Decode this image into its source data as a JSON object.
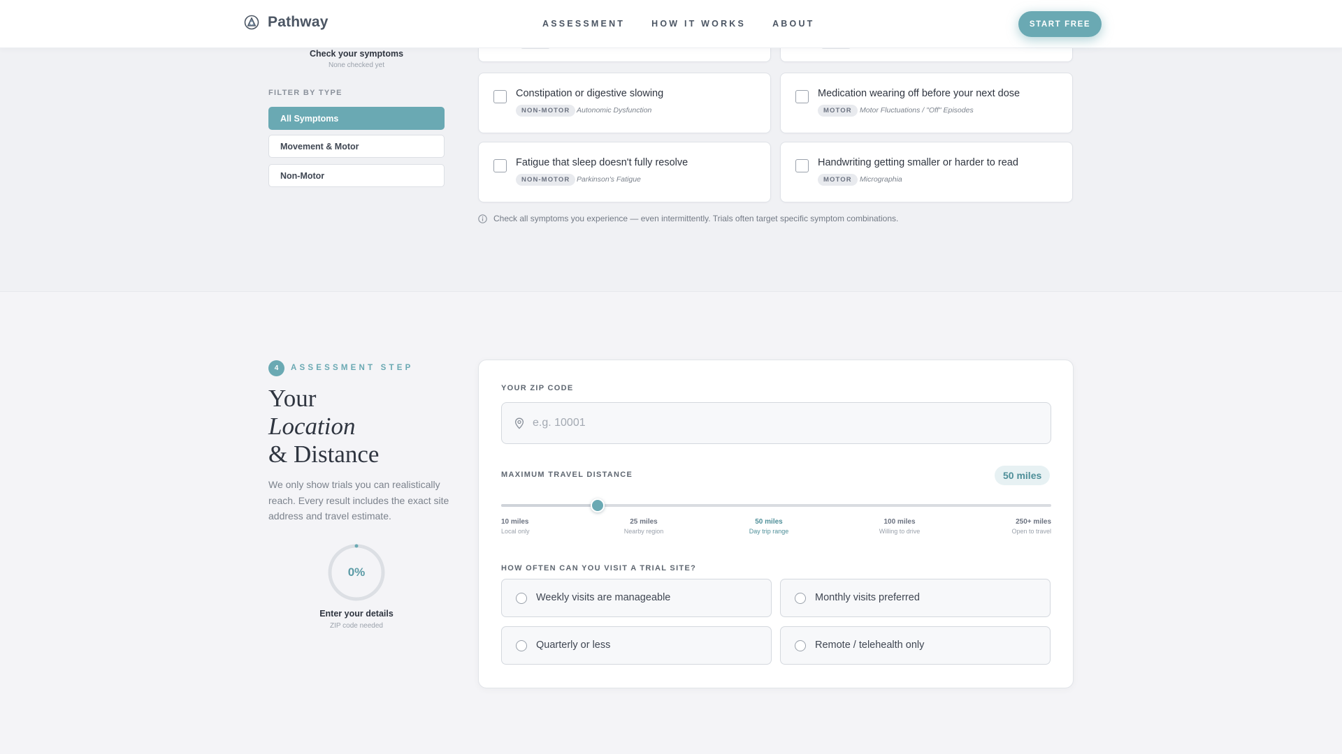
{
  "header": {
    "brand": "Pathway",
    "nav": [
      "ASSESSMENT",
      "HOW IT WORKS",
      "ABOUT"
    ],
    "cta": "START FREE"
  },
  "symptoms": {
    "sidebar_title": "Check your symptoms",
    "sidebar_sub": "None checked yet",
    "filter_label": "FILTER BY TYPE",
    "filters": [
      "All Symptoms",
      "Movement & Motor",
      "Non-Motor"
    ],
    "cards": [
      {
        "title": "Constipation or digestive slowing",
        "tag": "NON-MOTOR",
        "sub": "Autonomic Dysfunction"
      },
      {
        "title": "Medication wearing off before your next dose",
        "tag": "MOTOR",
        "sub": "Motor Fluctuations / \"Off\" Episodes"
      },
      {
        "title": "Fatigue that sleep doesn't fully resolve",
        "tag": "NON-MOTOR",
        "sub": "Parkinson's Fatigue"
      },
      {
        "title": "Handwriting getting smaller or harder to read",
        "tag": "MOTOR",
        "sub": "Micrographia"
      }
    ],
    "hint": "Check all symptoms you experience — even intermittently. Trials often target specific symptom combinations."
  },
  "location": {
    "step_number": "4",
    "step_label": "ASSESSMENT STEP",
    "heading_line1": "Your",
    "heading_line2": "Location",
    "heading_line3": "& Distance",
    "description": "We only show trials you can realistically reach. Every result includes the exact site address and travel estimate.",
    "progress_text": "0%",
    "progress_value": 0,
    "progress_title": "Enter your details",
    "progress_sub": "ZIP code needed",
    "zip_label": "YOUR ZIP CODE",
    "zip_placeholder": "e.g. 10001",
    "zip_value": "",
    "distance_label": "MAXIMUM TRAVEL DISTANCE",
    "distance_value": "50 miles",
    "slider_fraction": 0.175,
    "ticks": [
      {
        "value": "10 miles",
        "sub": "Local only"
      },
      {
        "value": "25 miles",
        "sub": "Nearby region"
      },
      {
        "value": "50 miles",
        "sub": "Day trip range"
      },
      {
        "value": "100 miles",
        "sub": "Willing to drive"
      },
      {
        "value": "250+ miles",
        "sub": "Open to travel"
      }
    ],
    "frequency_label": "HOW OFTEN CAN YOU VISIT A TRIAL SITE?",
    "frequency_options": [
      "Weekly visits are manageable",
      "Monthly visits preferred",
      "Quarterly or less",
      "Remote / telehealth only"
    ]
  },
  "colors": {
    "accent": "#6aa9b3",
    "accent_dark": "#4f8f99",
    "text": "#2f3540",
    "muted": "#7b828c",
    "background": "#f4f4f7"
  },
  "icons": {
    "brand": "pathway-logo-icon",
    "hint": "info-icon",
    "zip": "map-pin-icon"
  }
}
